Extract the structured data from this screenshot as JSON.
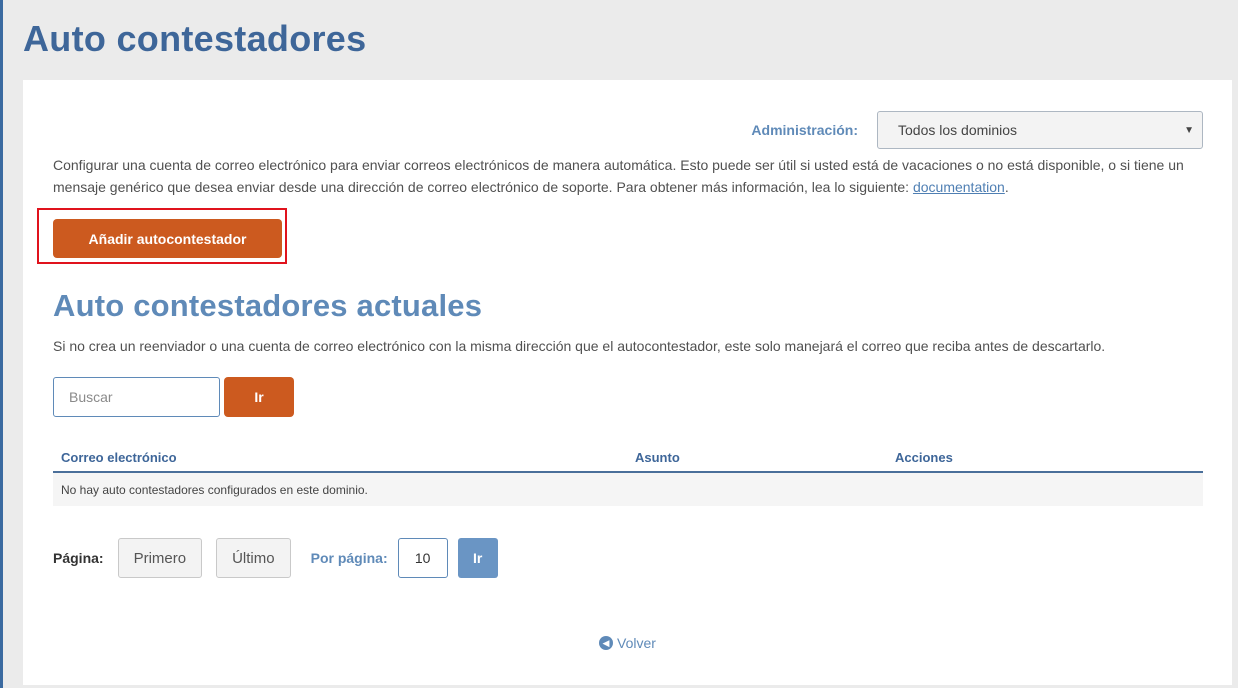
{
  "page": {
    "title": "Auto contestadores"
  },
  "admin": {
    "label": "Administración:",
    "selected": "Todos los dominios"
  },
  "intro": {
    "text": "Configurar una cuenta de correo electrónico para enviar correos electrónicos de manera automática. Esto puede ser útil si usted está de vacaciones o no está disponible, o si tiene un mensaje genérico que desea enviar desde una dirección de correo electrónico de soporte. Para obtener más información, lea lo siguiente:",
    "link": "documentation",
    "tail": "."
  },
  "add_button": "Añadir autocontestador",
  "current": {
    "title": "Auto contestadores actuales",
    "description": "Si no crea un reenviador o una cuenta de correo electrónico con la misma dirección que el autocontestador, este solo manejará el correo que reciba antes de descartarlo."
  },
  "search": {
    "placeholder": "Buscar",
    "go_label": "Ir"
  },
  "table": {
    "headers": [
      "Correo electrónico",
      "Asunto",
      "Acciones"
    ],
    "empty_message": "No hay auto contestadores configurados en este dominio."
  },
  "pagination": {
    "label": "Página:",
    "first": "Primero",
    "last": "Último",
    "per_page_label": "Por página:",
    "per_page_value": "10",
    "go_label": "Ir"
  },
  "back": {
    "label": "Volver",
    "icon": "arrow-left-circle-icon"
  },
  "colors": {
    "accent": "#cc5a1f",
    "primary": "#3e6699",
    "secondary": "#5f8ab8",
    "highlight": "#e0131d"
  }
}
